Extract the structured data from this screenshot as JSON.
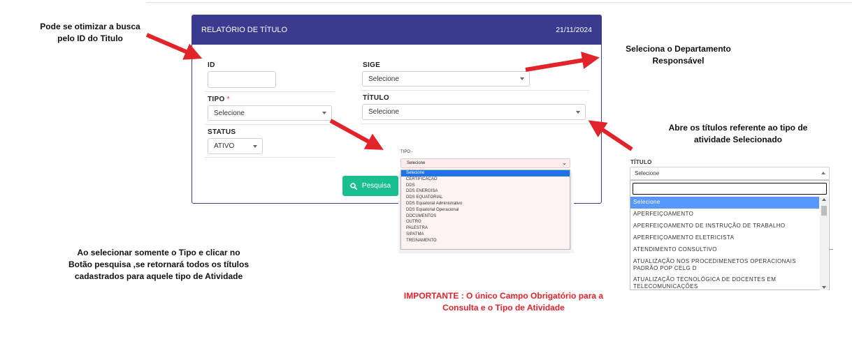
{
  "report": {
    "title": "RELATÓRIO DE TÍTULO",
    "date": "21/11/2024",
    "fields": {
      "id_label": "ID",
      "id_value": "",
      "tipo_label": "TIPO",
      "tipo_required_mark": "*",
      "tipo_value": "Selecione",
      "status_label": "STATUS",
      "status_value": "ATIVO",
      "sige_label": "SIGE",
      "sige_value": "Selecione",
      "titulo_label": "TÍTULO",
      "titulo_value": "Selecione"
    },
    "search_button": "Pesquisa",
    "search_icon": "search-icon"
  },
  "tipo_dropdown": {
    "label": "TIPO -",
    "selected": "Selecione",
    "options": [
      "Selecione",
      "CERTIFICAÇÃO",
      "DDS",
      "DDS ENERGISA",
      "DDS EQUATORIAL",
      "DDS Equatorial Administrativo",
      "DDS Equatorial Operacional",
      "DOCUMENTOS",
      "OUTRO",
      "PALESTRA",
      "SIPATMA",
      "TREINAMENTO"
    ]
  },
  "titulo_dropdown": {
    "label": "TÍTULO",
    "selected": "Selecione",
    "search_value": "",
    "options": [
      "Selecione",
      "APERFEIÇOAMENTO",
      "APERFEIÇOAMENTO DE INSTRUÇÃO DE TRABALHO",
      "APERFEIÇOAMENTO ELETRICISTA",
      "ATENDIMENTO CONSULTIVO",
      "ATUALIZAÇÃO NOS PROCEDIMENETOS OPERACIONAIS PADRÃO POP CELG D",
      "ATUALIZAÇÃO TECNOLÓGICA DE DOCENTES EM TELECOMUNICAÇÕES"
    ]
  },
  "annotations": {
    "id_note": "Pode se otimizar a busca  pelo ID do Titulo",
    "sige_note": "Seleciona o Departamento Responsável",
    "titulo_note": "Abre os títulos referente ao tipo de atividade Selecionado",
    "tipo_note": "Ao selecionar somente o Tipo e clicar no Botão pesquisa ,se retornará todos os títulos cadastrados para aquele tipo de Atividade",
    "important_note": "IMPORTANTE : O único Campo Obrigatório para a Consulta e o Tipo de Atividade"
  },
  "colors": {
    "header_bg": "#3a3b8f",
    "button_bg": "#19bf8f",
    "arrow": "#e0242a",
    "selected_option": "#1e73e8"
  }
}
